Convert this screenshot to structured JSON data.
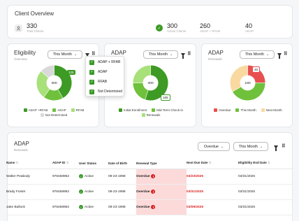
{
  "overview": {
    "title": "Client Overview",
    "total_value": "330",
    "total_label": "Total Clients",
    "active_value": "300",
    "active_label": "Active Clients",
    "adap_rfab_value": "260",
    "adap_rfab_label": "ADAP + RFAB",
    "adap_value": "40",
    "adap_label": "ADAP"
  },
  "eligibility": {
    "title": "Eligibility",
    "subtitle": "Overview",
    "dropdown": "This Month",
    "center": "300",
    "callout": "125",
    "legend": [
      "ADAP +RFAB",
      "ADAP",
      "RFAB",
      "Not Determined"
    ],
    "menu_items": [
      "ADAP + RFAB",
      "ADAP",
      "RFAB",
      "Not Determined"
    ]
  },
  "adap_chart": {
    "title": "ADAP",
    "dropdown": "This Month",
    "center": "300",
    "callout": "165",
    "legend": [
      "Initial Enrollment",
      "Mid-Term Check-in",
      "Renewals"
    ]
  },
  "adap_renewals_chart": {
    "title": "ADAP",
    "subtitle": "Renewals",
    "dropdown": "This Month",
    "center": "180",
    "callout": "45",
    "legend": [
      "Overdue",
      "This Month",
      "Next Month"
    ]
  },
  "table_card": {
    "title": "ADAP",
    "subtitle": "Renewals",
    "filter1": "Overdue",
    "filter2": "This Month",
    "columns": [
      "Name",
      "ADAP ID",
      "User Status",
      "Date of Birth",
      "Renewal Type",
      "Next Due Date",
      "Eligibility End Date"
    ],
    "rows": [
      {
        "name": "Walter Peabody",
        "id": "976458962",
        "status": "Active",
        "dob": "09-23-1998",
        "renewal": "Overdue",
        "due": "03/23/2025",
        "end": "03/31/2025"
      },
      {
        "name": "Brady Foster",
        "id": "976458962",
        "status": "Active",
        "dob": "09-23-1998",
        "renewal": "Overdue",
        "due": "03/31/2025",
        "end": "03/31/2025"
      },
      {
        "name": "Jake Bullock",
        "id": "976458962",
        "status": "Active",
        "dob": "09-23-1998",
        "renewal": "Overdue",
        "due": "03/09/2025",
        "end": "03/31/2025"
      }
    ]
  },
  "colors": {
    "dark_green": "#3d9a24",
    "mid_green": "#6fc13c",
    "light_green": "#a8e07a",
    "grey": "#d9d9d9",
    "red": "#e85050",
    "peach": "#f9d9a0",
    "overdue_bg": "#fcdada"
  },
  "chart_data": [
    {
      "type": "pie",
      "title": "Eligibility",
      "categories": [
        "ADAP +RFAB",
        "ADAP",
        "RFAB",
        "Not Determined"
      ],
      "values": [
        125,
        55,
        80,
        40
      ]
    },
    {
      "type": "pie",
      "title": "ADAP",
      "categories": [
        "Initial Enrollment",
        "Mid-Term Check-in",
        "Renewals"
      ],
      "values": [
        165,
        60,
        75
      ]
    },
    {
      "type": "pie",
      "title": "ADAP",
      "categories": [
        "Overdue",
        "This Month",
        "Next Month"
      ],
      "values": [
        45,
        75,
        60
      ]
    }
  ]
}
